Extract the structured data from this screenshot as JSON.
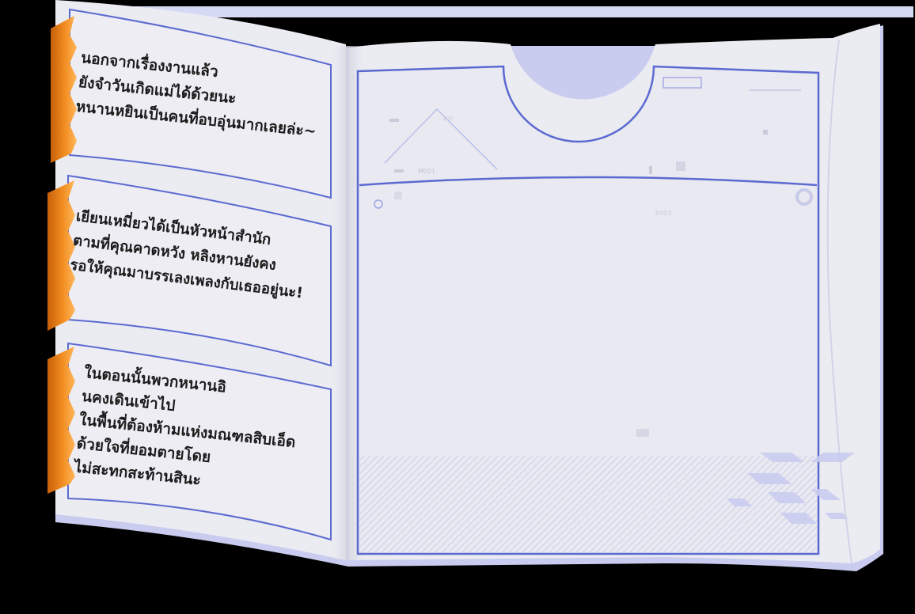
{
  "colors": {
    "background": "#000000",
    "paper": "#ebebf2",
    "paper_edge": "#c9ccef",
    "frame_blue": "#5b6ad0",
    "tab_orange": "#f08a1c",
    "text": "#1b1b1b"
  },
  "notes": [
    {
      "lines": [
        "นอกจากเรื่องงานแล้ว",
        "ยังจำวันเกิดแม่ได้ด้วยนะ",
        "หนานหยินเป็นคนที่อบอุ่นมากเลยล่ะ~"
      ]
    },
    {
      "lines": [
        "เยียนเหมี่ยวได้เป็นหัวหน้าสำนัก",
        "ตามที่คุณคาดหวัง หลิงหานยังคง",
        "รอให้คุณมาบรรเลงเพลงกับเธออยู่นะ!"
      ]
    },
    {
      "lines": [
        "ในตอนนั้นพวกหนานอิ",
        "นคงเดินเข้าไป",
        "ในพื้นที่ต้องห้ามแห่งมณฑลสิบเอ็ด",
        "ด้วยใจที่ยอมตายโดย",
        "ไม่สะทกสะท้านสินะ"
      ]
    }
  ],
  "photo_page": {
    "faint_labels": [
      "M001",
      "100",
      "E003"
    ]
  }
}
